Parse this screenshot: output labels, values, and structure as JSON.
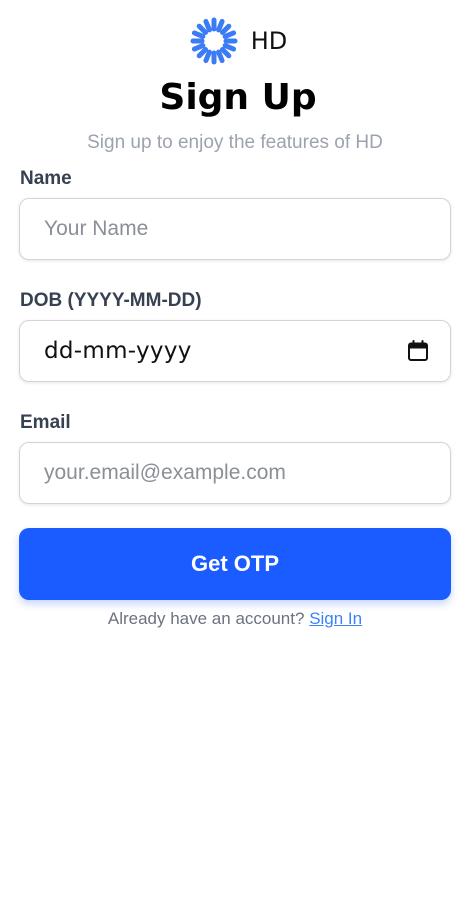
{
  "brand": {
    "name": "HD",
    "logo_icon": "sunburst-logo-icon",
    "logo_color": "#3b7bf6"
  },
  "header": {
    "title": "Sign Up",
    "subtitle": "Sign up to enjoy the features of HD"
  },
  "form": {
    "name": {
      "label": "Name",
      "placeholder": "Your Name",
      "value": ""
    },
    "dob": {
      "label": "DOB (YYYY-MM-DD)",
      "display_value": "dd-mm-yyyy",
      "icon": "calendar-icon"
    },
    "email": {
      "label": "Email",
      "placeholder": "your.email@example.com",
      "value": ""
    },
    "submit_label": "Get OTP"
  },
  "footer": {
    "prompt": "Already have an account?",
    "link_label": "Sign In"
  },
  "colors": {
    "primary": "#1a5cff",
    "link": "#3b82f6",
    "muted": "#9ca3af",
    "label": "#374151"
  }
}
